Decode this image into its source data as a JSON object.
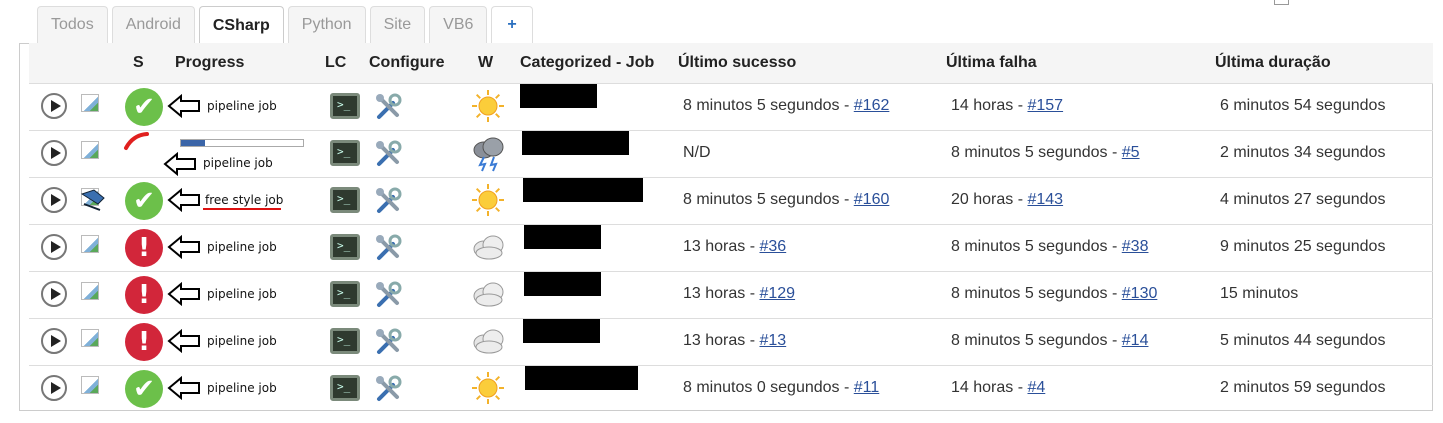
{
  "tabs": [
    "Todos",
    "Android",
    "CSharp",
    "Python",
    "Site",
    "VB6",
    "+"
  ],
  "active_tab": "CSharp",
  "columns": {
    "s": "S",
    "progress": "Progress",
    "lc": "LC",
    "configure": "Configure",
    "w": "W",
    "job": "Categorized - Job",
    "last_success": "Último sucesso",
    "last_failure": "Última falha",
    "last_duration": "Última duração"
  },
  "colors": {
    "success": "#6cc04a",
    "failure": "#d2263a",
    "link": "#2a4f99",
    "progress_fill": "#3b65a8"
  },
  "rows": [
    {
      "status": "success",
      "job_type": "pipeline job",
      "weather": "sunny-icon",
      "success_text": "8 minutos 5 segundos - ",
      "success_link": "#162",
      "failure_text": "14 horas - ",
      "failure_link": "#157",
      "duration": "6 minutos 54 segundos"
    },
    {
      "status": "running",
      "progress": 0.2,
      "job_type": "pipeline job",
      "weather": "storm-icon",
      "success_text": "N/D",
      "success_link": "",
      "failure_text": "8 minutos 5 segundos - ",
      "failure_link": "#5",
      "duration": "2 minutos 34 segundos"
    },
    {
      "status": "success",
      "job_type": "free style job",
      "weather": "sunny-icon",
      "success_text": "8 minutos 5 segundos - ",
      "success_link": "#160",
      "failure_text": "20 horas - ",
      "failure_link": "#143",
      "duration": "4 minutos 27 segundos"
    },
    {
      "status": "failure",
      "job_type": "pipeline job",
      "weather": "cloudy-icon",
      "success_text": "13 horas - ",
      "success_link": "#36",
      "failure_text": "8 minutos 5 segundos - ",
      "failure_link": "#38",
      "duration": "9 minutos 25 segundos"
    },
    {
      "status": "failure",
      "job_type": "pipeline job",
      "weather": "cloudy-icon",
      "success_text": "13 horas - ",
      "success_link": "#129",
      "failure_text": "8 minutos 5 segundos - ",
      "failure_link": "#130",
      "duration": "15 minutos"
    },
    {
      "status": "failure",
      "job_type": "pipeline job",
      "weather": "cloudy-icon",
      "success_text": "13 horas - ",
      "success_link": "#13",
      "failure_text": "8 minutos 5 segundos - ",
      "failure_link": "#14",
      "duration": "5 minutos 44 segundos"
    },
    {
      "status": "success",
      "job_type": "pipeline job",
      "weather": "sunny-icon",
      "success_text": "8 minutos 0 segundos - ",
      "success_link": "#11",
      "failure_text": "14 horas - ",
      "failure_link": "#4",
      "duration": "2 minutos 59 segundos"
    }
  ]
}
